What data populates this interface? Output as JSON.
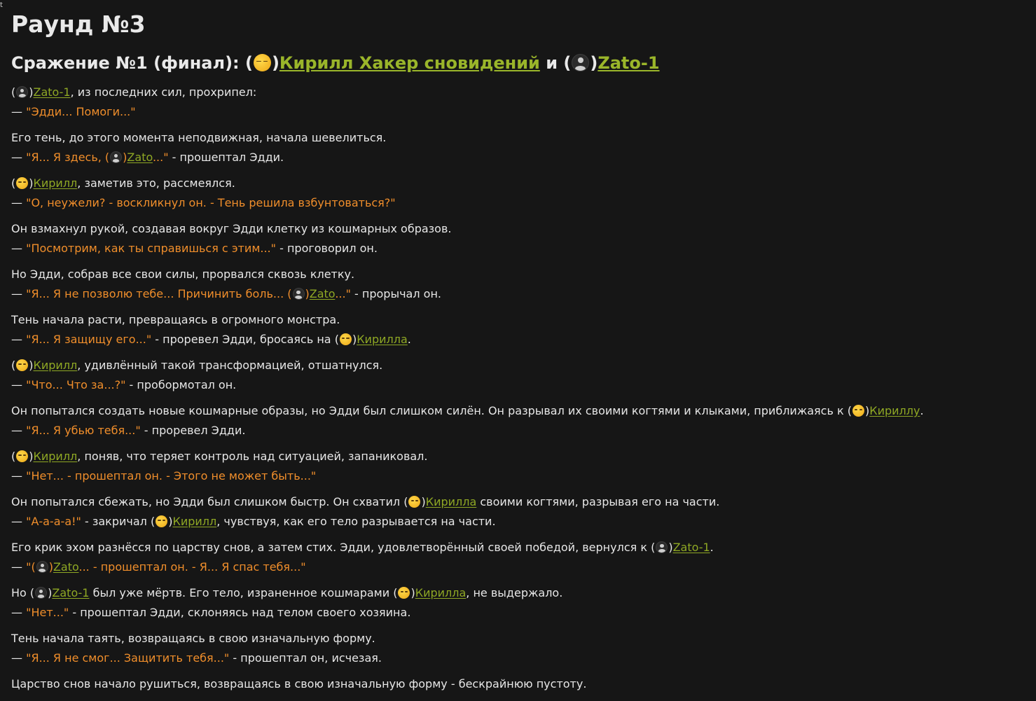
{
  "corner_glyph": "t",
  "title": "Раунд №3",
  "battle": {
    "prefix": "Сражение №1 (финал): (",
    "close1": ")",
    "player1": "Кирилл Хакер сновидений",
    "conj": " и (",
    "close2": ")",
    "player2": "Zato-1"
  },
  "icons": {
    "player1_avatar": "sleeping-face-icon",
    "player2_avatar": "hacker-avatar-icon"
  },
  "colors": {
    "background": "#161616",
    "text": "#e7e7e7",
    "quote": "#f08e2b",
    "link": "#8fa824"
  },
  "story": [
    {
      "l1": {
        "b": "(",
        "c": ")",
        "name": "Zato-1",
        "a": ", из последних сил, прохрипел:"
      },
      "l2": {
        "dash": "— ",
        "q": "\"Эдди... Помоги...\""
      }
    },
    {
      "l1": {
        "t": "Его тень, до этого момента неподвижная, начала шевелиться."
      },
      "l2": {
        "dash": "— ",
        "q1": "\"Я... Я здесь, (",
        "c": ")",
        "name": "Zato",
        "q2": "...\"",
        "a": " - прошептал Эдди."
      }
    },
    {
      "l1": {
        "b": "(",
        "c": ")",
        "name": "Кирилл",
        "a": ", заметив это, рассмеялся."
      },
      "l2": {
        "dash": "— ",
        "q": "\"О, неужели? - воскликнул он. - Тень решила взбунтоваться?\""
      }
    },
    {
      "l1": {
        "t": "Он взмахнул рукой, создавая вокруг Эдди клетку из кошмарных образов."
      },
      "l2": {
        "dash": "— ",
        "q": "\"Посмотрим, как ты справишься с этим...\"",
        "a": " - проговорил он."
      }
    },
    {
      "l1": {
        "t": "Но Эдди, собрав все свои силы, прорвался сквозь клетку."
      },
      "l2": {
        "dash": "— ",
        "q1": "\"Я... Я не позволю тебе... Причинить боль... (",
        "c": ")",
        "name": "Zato",
        "q2": "...\"",
        "a": " - прорычал он."
      }
    },
    {
      "l1": {
        "t": "Тень начала расти, превращаясь в огромного монстра."
      },
      "l2": {
        "dash": "— ",
        "q": "\"Я... Я защищу его...\"",
        "a1": " - проревел Эдди, бросаясь на (",
        "c": ")",
        "name": "Кирилла",
        "a2": "."
      }
    },
    {
      "l1": {
        "b": "(",
        "c": ")",
        "name": "Кирилл",
        "a": ", удивлённый такой трансформацией, отшатнулся."
      },
      "l2": {
        "dash": "— ",
        "q": "\"Что... Что за...?\"",
        "a": " - пробормотал он."
      }
    },
    {
      "l1": {
        "t": "Он попытался создать новые кошмарные образы, но Эдди был слишком силён. Он разрывал их своими когтями и клыками, приближаясь к (",
        "c": ")",
        "name": "Кириллу",
        "a": "."
      },
      "l2": {
        "dash": "— ",
        "q": "\"Я... Я убью тебя...\"",
        "a": " - проревел Эдди."
      }
    },
    {
      "l1": {
        "b": "(",
        "c": ")",
        "name": "Кирилл",
        "a": ", поняв, что теряет контроль над ситуацией, запаниковал."
      },
      "l2": {
        "dash": "— ",
        "q": "\"Нет... - прошептал он. - Этого не может быть...\""
      }
    },
    {
      "l1": {
        "t": "Он попытался сбежать, но Эдди был слишком быстр. Он схватил (",
        "c": ")",
        "name": "Кирилла",
        "a": " своими когтями, разрывая его на части."
      },
      "l2": {
        "dash": "— ",
        "q": "\"А-а-а-а!\"",
        "a1": " - закричал (",
        "c": ")",
        "name": "Кирилл",
        "a2": ", чувствуя, как его тело разрывается на части."
      }
    },
    {
      "l1": {
        "t": "Его крик эхом разнёсся по царству снов, а затем стих. Эдди, удовлетворённый своей победой, вернулся к (",
        "c": ")",
        "name": "Zato-1",
        "a": "."
      },
      "l2": {
        "dash": "— ",
        "q1": "\"(",
        "c": ")",
        "name": "Zato",
        "q2": "... - прошептал он. - Я... Я спас тебя...\""
      }
    },
    {
      "l1": {
        "b": "Но (",
        "c1": ")",
        "name1": "Zato-1",
        "m": " был уже мёртв. Его тело, израненное кошмарами (",
        "c2": ")",
        "name2": "Кирилла",
        "a": ", не выдержало."
      },
      "l2": {
        "dash": "— ",
        "q": "\"Нет...\"",
        "a": " - прошептал Эдди, склоняясь над телом своего хозяина."
      }
    },
    {
      "l1": {
        "t": "Тень начала таять, возвращаясь в свою изначальную форму."
      },
      "l2": {
        "dash": "— ",
        "q": "\"Я... Я не смог... Защитить тебя...\"",
        "a": " - прошептал он, исчезая."
      }
    },
    {
      "l1": {
        "t": "Царство снов начало рушиться, возвращаясь в свою изначальную форму - бескрайнюю пустоту."
      }
    }
  ]
}
